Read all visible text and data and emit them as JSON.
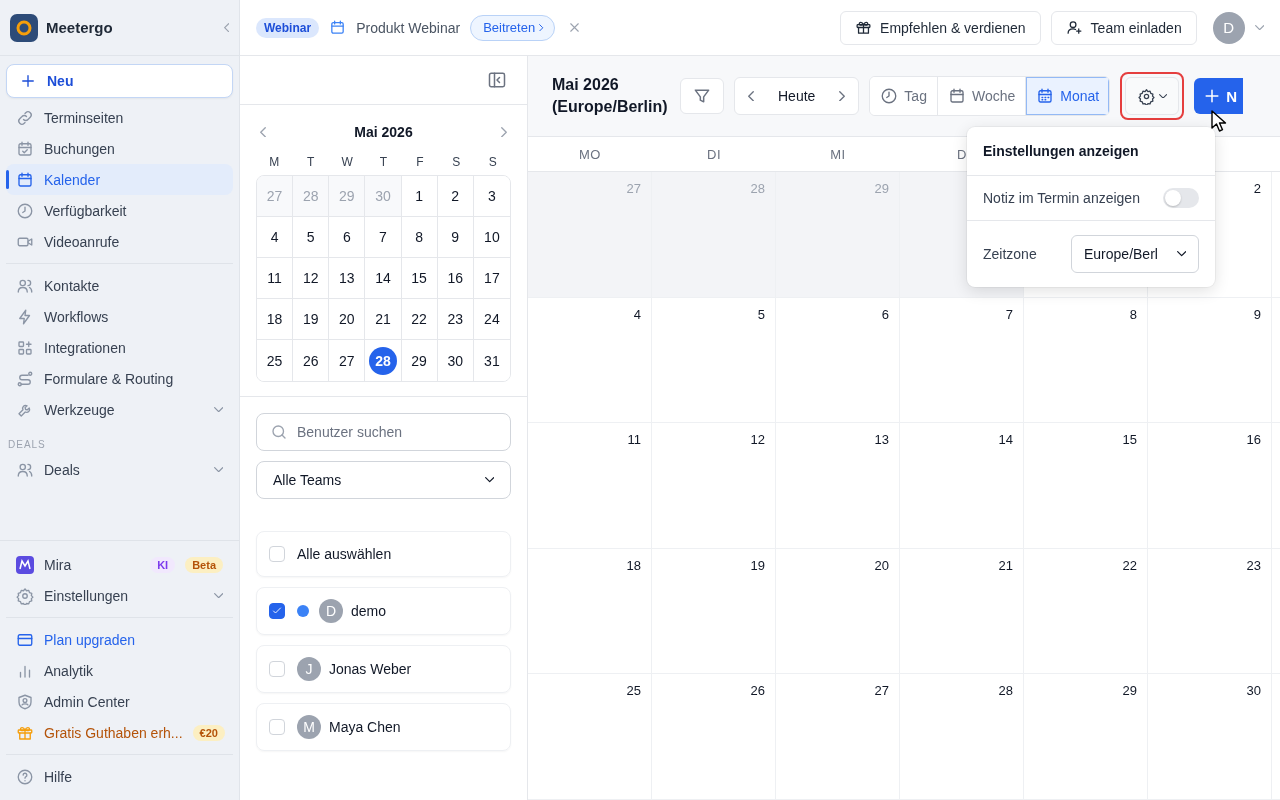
{
  "sidebar": {
    "brand": "Meetergo",
    "new_button": "Neu",
    "sections": [
      {
        "items": [
          {
            "label": "Terminseiten",
            "kind": "link",
            "selected": false
          },
          {
            "label": "Buchungen",
            "kind": "link",
            "selected": false
          },
          {
            "label": "Kalender",
            "kind": "link",
            "selected": true
          },
          {
            "label": "Verfügbarkeit",
            "kind": "link",
            "selected": false
          },
          {
            "label": "Videoanrufe",
            "kind": "link",
            "selected": false
          }
        ]
      },
      {
        "items": [
          {
            "label": "Kontakte",
            "kind": "link",
            "selected": false
          },
          {
            "label": "Workflows",
            "kind": "link",
            "selected": false
          },
          {
            "label": "Integrationen",
            "kind": "link",
            "selected": false
          },
          {
            "label": "Formulare & Routing",
            "kind": "link",
            "selected": false
          },
          {
            "label": "Werkzeuge",
            "kind": "group",
            "selected": false
          }
        ]
      },
      {
        "heading": "DEALS",
        "items": [
          {
            "label": "Deals",
            "kind": "group",
            "selected": false
          }
        ]
      }
    ],
    "bottom_sections": [
      {
        "items": [
          {
            "label": "Mira",
            "kind": "link",
            "selected": false,
            "badges": [
              {
                "text": "KI",
                "kind": "ai"
              },
              {
                "text": "Beta",
                "kind": "beta"
              }
            ]
          },
          {
            "label": "Einstellungen",
            "kind": "group",
            "selected": false
          }
        ]
      },
      {
        "items": [
          {
            "label": "Plan upgraden",
            "kind": "upgrade",
            "selected": false
          },
          {
            "label": "Analytik",
            "kind": "link",
            "selected": false
          },
          {
            "label": "Admin Center",
            "kind": "link",
            "selected": false
          },
          {
            "label": "Gratis Guthaben erh...",
            "kind": "promo",
            "selected": false,
            "badges": [
              {
                "text": "€20",
                "kind": "beta"
              }
            ]
          }
        ]
      },
      {
        "items": [
          {
            "label": "Hilfe",
            "kind": "link",
            "selected": false
          }
        ]
      }
    ]
  },
  "topbar": {
    "event_tag": "Webinar",
    "event_title": "Produkt Webinar",
    "join_button": "Beitreten",
    "buttons": [
      "Empfehlen & verdienen",
      "Team einladen"
    ],
    "avatar": "D"
  },
  "mini_calendar": {
    "month": "Mai 2026",
    "weekdays": [
      "M",
      "T",
      "W",
      "T",
      "F",
      "S",
      "S"
    ],
    "weeks": [
      [
        {
          "day": "27",
          "outside": true,
          "selected": false
        },
        {
          "day": "28",
          "outside": true,
          "selected": false
        },
        {
          "day": "29",
          "outside": true,
          "selected": false
        },
        {
          "day": "30",
          "outside": true,
          "selected": false
        },
        {
          "day": "1",
          "outside": false,
          "selected": false
        },
        {
          "day": "2",
          "outside": false,
          "selected": false
        },
        {
          "day": "3",
          "outside": false,
          "selected": false
        }
      ],
      [
        {
          "day": "4",
          "outside": false,
          "selected": false
        },
        {
          "day": "5",
          "outside": false,
          "selected": false
        },
        {
          "day": "6",
          "outside": false,
          "selected": false
        },
        {
          "day": "7",
          "outside": false,
          "selected": false
        },
        {
          "day": "8",
          "outside": false,
          "selected": false
        },
        {
          "day": "9",
          "outside": false,
          "selected": false
        },
        {
          "day": "10",
          "outside": false,
          "selected": false
        }
      ],
      [
        {
          "day": "11",
          "outside": false,
          "selected": false
        },
        {
          "day": "12",
          "outside": false,
          "selected": false
        },
        {
          "day": "13",
          "outside": false,
          "selected": false
        },
        {
          "day": "14",
          "outside": false,
          "selected": false
        },
        {
          "day": "15",
          "outside": false,
          "selected": false
        },
        {
          "day": "16",
          "outside": false,
          "selected": false
        },
        {
          "day": "17",
          "outside": false,
          "selected": false
        }
      ],
      [
        {
          "day": "18",
          "outside": false,
          "selected": false
        },
        {
          "day": "19",
          "outside": false,
          "selected": false
        },
        {
          "day": "20",
          "outside": false,
          "selected": false
        },
        {
          "day": "21",
          "outside": false,
          "selected": false
        },
        {
          "day": "22",
          "outside": false,
          "selected": false
        },
        {
          "day": "23",
          "outside": false,
          "selected": false
        },
        {
          "day": "24",
          "outside": false,
          "selected": false
        }
      ],
      [
        {
          "day": "25",
          "outside": false,
          "selected": false
        },
        {
          "day": "26",
          "outside": false,
          "selected": false
        },
        {
          "day": "27",
          "outside": false,
          "selected": false
        },
        {
          "day": "28",
          "outside": false,
          "selected": true
        },
        {
          "day": "29",
          "outside": false,
          "selected": false
        },
        {
          "day": "30",
          "outside": false,
          "selected": false
        },
        {
          "day": "31",
          "outside": false,
          "selected": false
        }
      ]
    ]
  },
  "user_filter": {
    "search_placeholder": "Benutzer suchen",
    "team_select": "Alle Teams",
    "select_all": {
      "label": "Alle auswählen",
      "checked": false
    },
    "users": [
      {
        "name": "demo",
        "initial": "D",
        "checked": true,
        "color": "#3b82f6"
      },
      {
        "name": "Jonas Weber",
        "initial": "J",
        "checked": false
      },
      {
        "name": "Maya Chen",
        "initial": "M",
        "checked": false
      }
    ]
  },
  "calendar": {
    "title": "Mai 2026 (Europe/Berlin)",
    "today_button": "Heute",
    "views": [
      {
        "label": "Tag",
        "selected": false
      },
      {
        "label": "Woche",
        "selected": false
      },
      {
        "label": "Monat",
        "selected": true
      }
    ],
    "new_button": "N",
    "weekdays": [
      "MO",
      "DI",
      "MI",
      "D"
    ],
    "weeks": [
      [
        {
          "day": "27",
          "outside": true
        },
        {
          "day": "28",
          "outside": true
        },
        {
          "day": "29",
          "outside": true
        },
        {
          "outside": true
        },
        {
          "outside": false
        },
        {
          "day": "2",
          "outside": false
        }
      ],
      [
        {
          "day": "4",
          "outside": false
        },
        {
          "day": "5",
          "outside": false
        },
        {
          "day": "6",
          "outside": false
        },
        {
          "day": "7",
          "outside": false
        },
        {
          "day": "8",
          "outside": false
        },
        {
          "day": "9",
          "outside": false
        }
      ],
      [
        {
          "day": "11",
          "outside": false
        },
        {
          "day": "12",
          "outside": false
        },
        {
          "day": "13",
          "outside": false
        },
        {
          "day": "14",
          "outside": false
        },
        {
          "day": "15",
          "outside": false
        },
        {
          "day": "16",
          "outside": false
        }
      ],
      [
        {
          "day": "18",
          "outside": false
        },
        {
          "day": "19",
          "outside": false
        },
        {
          "day": "20",
          "outside": false
        },
        {
          "day": "21",
          "outside": false
        },
        {
          "day": "22",
          "outside": false
        },
        {
          "day": "23",
          "outside": false
        }
      ],
      [
        {
          "day": "25",
          "outside": false
        },
        {
          "day": "26",
          "outside": false
        },
        {
          "day": "27",
          "outside": false
        },
        {
          "day": "28",
          "outside": false
        },
        {
          "day": "29",
          "outside": false
        },
        {
          "day": "30",
          "outside": false
        }
      ]
    ]
  },
  "settings_menu": {
    "title": "Einstellungen anzeigen",
    "note_toggle": {
      "label": "Notiz im Termin anzeigen",
      "on": false
    },
    "timezone": {
      "label": "Zeitzone",
      "value": "Europe/Berl"
    }
  }
}
